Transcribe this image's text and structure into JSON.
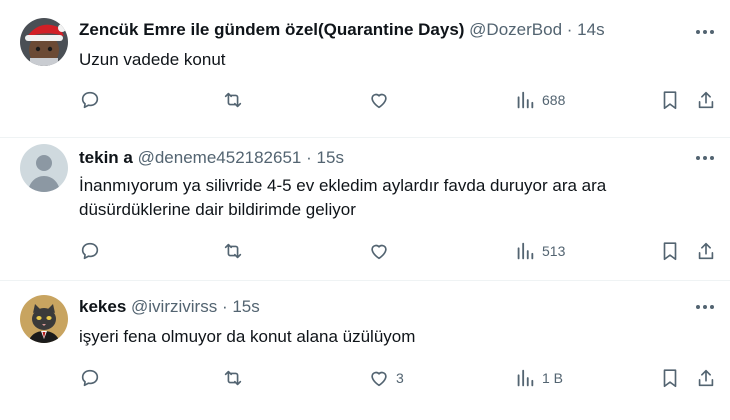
{
  "tweets": [
    {
      "name": "Zencük Emre ile gündem özel(Quarantine Days)",
      "handle": "@DozerBod",
      "time": "14s",
      "text": "Uzun vadede konut",
      "replies": "",
      "retweets": "",
      "likes": "",
      "views": "688",
      "avatar_icon": "santa-hat-baby-avatar"
    },
    {
      "name": "tekin a",
      "handle": "@deneme452182651",
      "time": "15s",
      "text": "İnanmıyorum ya silivride 4-5 ev ekledim aylardır favda duruyor ara ara düsürdüklerine dair bildirimde geliyor",
      "replies": "",
      "retweets": "",
      "likes": "",
      "views": "513",
      "avatar_icon": "default-person-avatar"
    },
    {
      "name": "kekes",
      "handle": "@ivirzivirss",
      "time": "15s",
      "text": "işyeri fena olmuyor da konut alana üzülüyom",
      "replies": "",
      "retweets": "",
      "likes": "3",
      "views": "1 B",
      "avatar_icon": "cat-in-suit-avatar"
    }
  ],
  "separator": "·",
  "colors": {
    "text": "#0f1419",
    "secondary": "#536471",
    "divider": "#eff3f4"
  }
}
